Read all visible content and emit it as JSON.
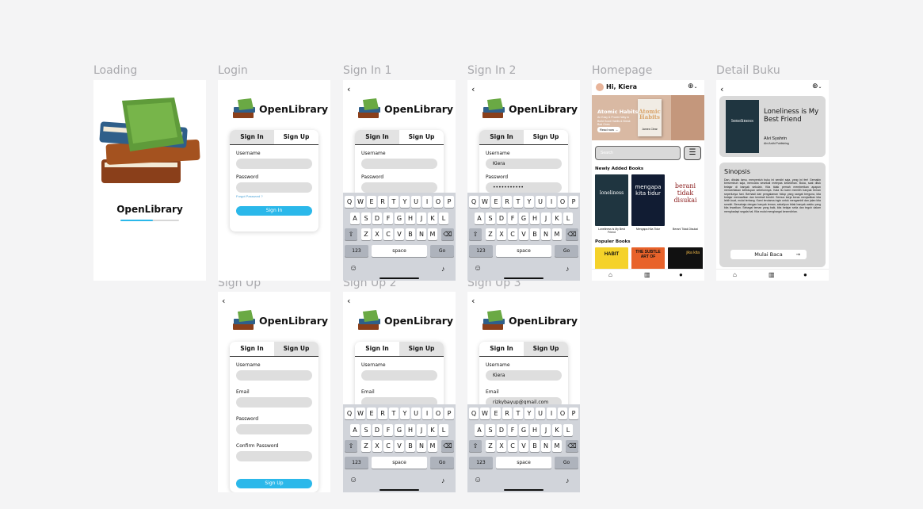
{
  "frames": {
    "loading": "Loading",
    "login": "Login",
    "signin1": "Sign In 1",
    "signin2": "Sign In 2",
    "homepage": "Homepage",
    "detail": "Detail Buku",
    "signup": "Sign Up",
    "signup2": "Sign Up 2",
    "signup3": "Sign Up 3"
  },
  "brand": "OpenLibrary",
  "loading_progress": 0.55,
  "back_glyph": "‹",
  "tabs": {
    "signin": "Sign In",
    "signup": "Sign Up"
  },
  "labels": {
    "username": "Username",
    "password": "Password",
    "email": "Email",
    "confirm": "Confirm Password",
    "forgot": "Forgot Password ?"
  },
  "values": {
    "username": "Kiera",
    "password": "•••••••••••",
    "email": "rizkybayup@gmail.com"
  },
  "buttons": {
    "signin": "Sign In",
    "signup": "Sign Up"
  },
  "keyboard": {
    "row1": [
      "Q",
      "W",
      "E",
      "R",
      "T",
      "Y",
      "U",
      "I",
      "O",
      "P"
    ],
    "row2": [
      "A",
      "S",
      "D",
      "F",
      "G",
      "H",
      "J",
      "K",
      "L"
    ],
    "row3": [
      "Z",
      "X",
      "C",
      "V",
      "B",
      "N",
      "M"
    ],
    "shift": "⇧",
    "delete": "⌫",
    "num": "123",
    "space": "space",
    "go": "Go",
    "emoji": "☺",
    "mic": "♪"
  },
  "home": {
    "greeting": "Hi, Kiera",
    "banner_title": "Atomic Habits",
    "banner_sub": "An Easy & Proven Way to Build Good Habits & Break Bad Ones",
    "banner_btn": "Read now →",
    "banner_cover_t1": "Atomic",
    "banner_cover_t2": "Habits",
    "banner_author": "James Clear",
    "search_placeholder": "Search",
    "newly": "Newly Added Books",
    "popular": "Populer Books",
    "books": [
      {
        "cover": "loneliness",
        "title": "Loneliness is My Best Friend"
      },
      {
        "cover": "mengapa kita tidur",
        "title": "Mengapa Kita Tidur"
      },
      {
        "cover": "berani tidak disukai",
        "title": "Berani Tidak Disukai"
      }
    ],
    "popular_covers": [
      "HABIT",
      "THE SUBTLE ART OF",
      "jika kita"
    ]
  },
  "detail": {
    "cover_title": "loneliness",
    "title": "Loneliness is My Best Friend",
    "author": "Alvi Syahrin",
    "publisher": "Alvi Ardhi Publishing",
    "synopsis_title": "Sinopsis",
    "synopsis": "Dan, ditolak lamu, menyentuh buku ini sendiri saja, yang ini fee! Gemakin bersembuh saja, mencoba sesekali melepas kesedihan. Buka, saat dituk belajar di banyak sekolah. Kita tidak pernah memberikan apapun menceritakan kehidupan sebelumnya. Kala itu kami memilih banyak teman seperlunya hari. Berhasil dari pengalaman hidup yang sangat berguna, kita belajar memaafkan dan kembali berdiri. Semua kerja keras menjadikan kita lebih kuat, mulai terbang. Kami terutama ingin untuk mengambil dan jalan kita sendiri. Bersahaja dengan banyak teman, sekalipun tidak banyak waktu yang kita lewatkan. Sebagai teman yang baik, kita belajar setia dan teguh dalam menghadapi segala hal. Kita mulai menghargai kesendirian.",
    "cta": "Mulai Baca",
    "cta_icon": "→"
  }
}
